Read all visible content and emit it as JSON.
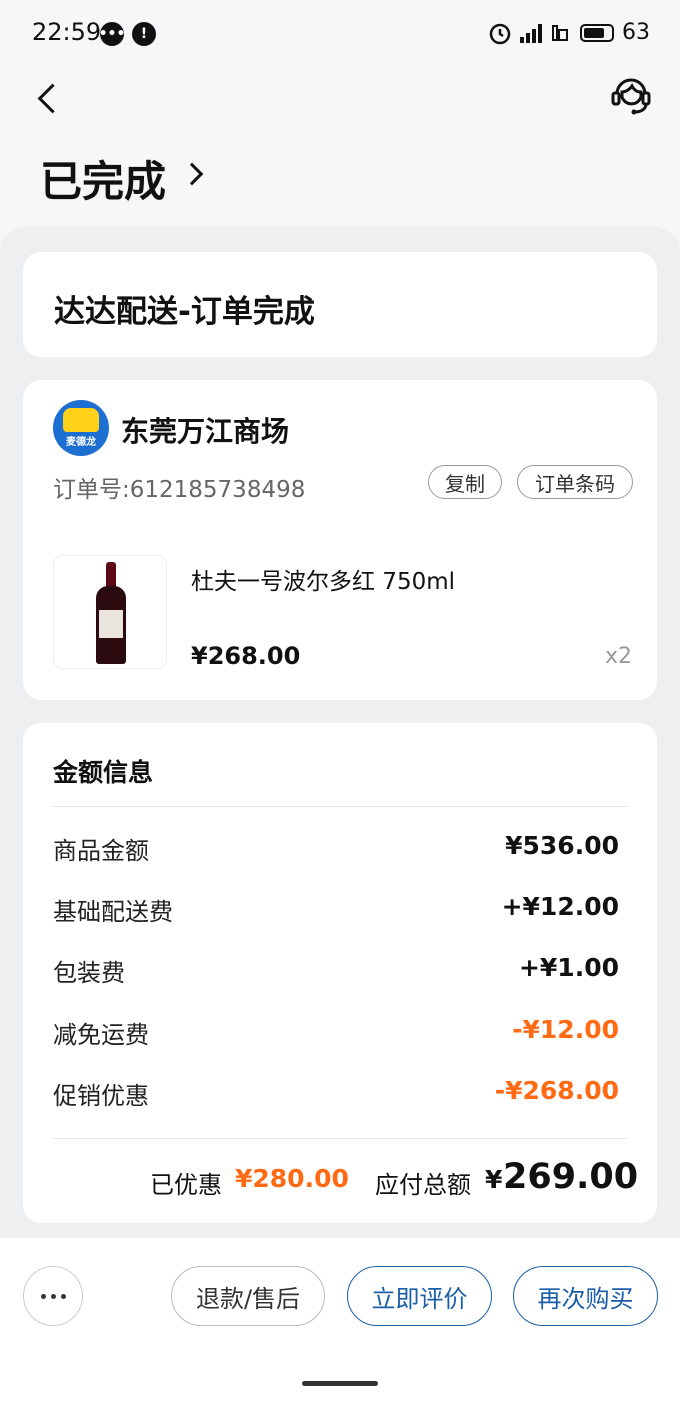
{
  "status_bar": {
    "time": "22:59",
    "battery": "63",
    "network": "4G",
    "icons": [
      "chat-bubble-icon",
      "alert-icon",
      "alarm-icon",
      "signal-icon",
      "hd-icon",
      "battery-icon"
    ]
  },
  "header": {
    "title": "已完成",
    "back_icon": "chevron-left-icon",
    "service_icon": "customer-service-icon"
  },
  "status_card": {
    "text": "达达配送-订单完成"
  },
  "shop": {
    "name": "东莞万江商场",
    "logo_text": "麦德龙",
    "order_number": "订单号:612185738498",
    "copy_label": "复制",
    "barcode_label": "订单条码"
  },
  "product": {
    "name": "杜夫一号波尔多红 750ml",
    "price": "¥268.00",
    "qty": "x2"
  },
  "amount": {
    "title": "金额信息",
    "rows": [
      {
        "label": "商品金额",
        "value": "¥536.00",
        "highlight": false
      },
      {
        "label": "基础配送费",
        "value": "+¥12.00",
        "highlight": false
      },
      {
        "label": "包装费",
        "value": "+¥1.00",
        "highlight": false
      },
      {
        "label": "减免运费",
        "value": "-¥12.00",
        "highlight": true
      },
      {
        "label": "促销优惠",
        "value": "-¥268.00",
        "highlight": true
      }
    ],
    "saved_label": "已优惠",
    "saved_value": "¥280.00",
    "total_label": "应付总额",
    "total_symbol": "¥",
    "total_value": "269.00"
  },
  "actions": {
    "more_icon": "more-dots-icon",
    "refund_label": "退款/售后",
    "review_label": "立即评价",
    "rebuy_label": "再次购买"
  },
  "colors": {
    "accent_orange": "#ff6a13",
    "accent_blue": "#1b5ea8",
    "background": "#eeeff1"
  }
}
